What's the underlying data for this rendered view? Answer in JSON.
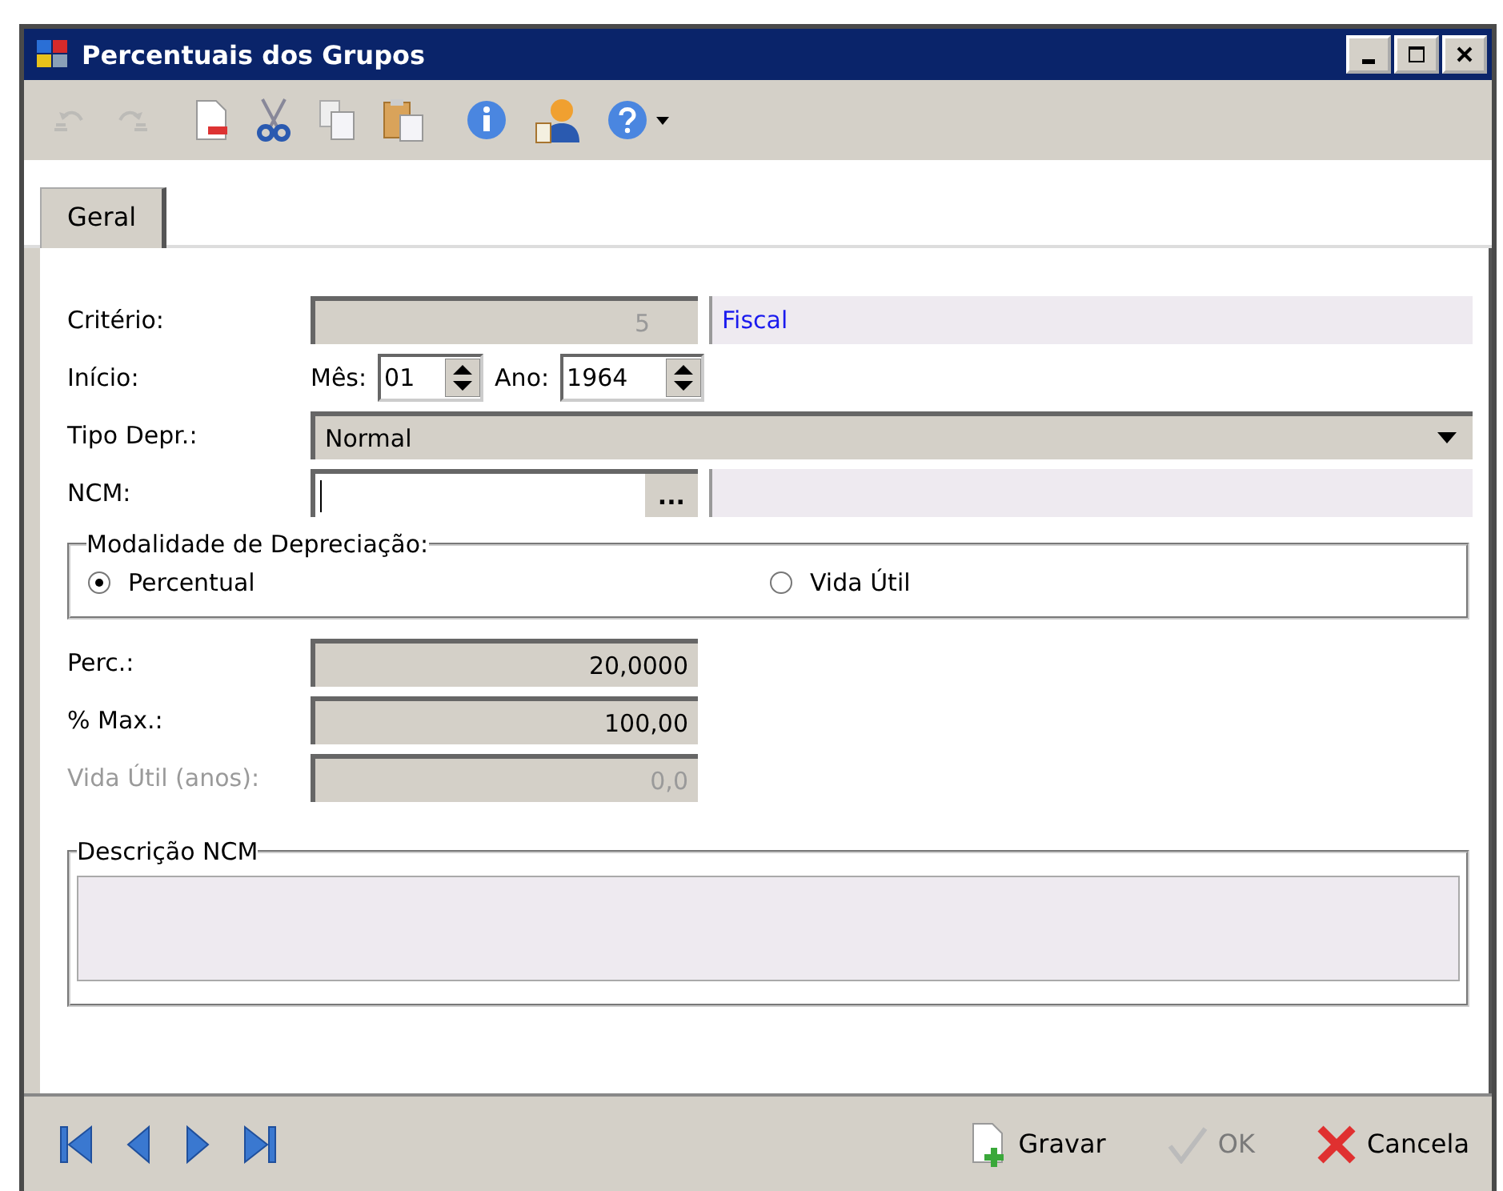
{
  "window": {
    "title": "Percentuais dos Grupos"
  },
  "toolbar": [
    {
      "kind": "undo",
      "disabled": true
    },
    {
      "kind": "redo",
      "disabled": true
    },
    {
      "kind": "delete",
      "disabled": false
    },
    {
      "kind": "cut",
      "disabled": false
    },
    {
      "kind": "copy",
      "disabled": false
    },
    {
      "kind": "paste",
      "disabled": false
    },
    {
      "kind": "info",
      "disabled": false
    },
    {
      "kind": "user",
      "disabled": false
    },
    {
      "kind": "help",
      "disabled": false
    }
  ],
  "tabs": [
    {
      "label": "Geral",
      "selected": true
    }
  ],
  "form": {
    "criterio": {
      "label": "Critério:",
      "code": "5",
      "description": "Fiscal"
    },
    "inicio": {
      "label": "Início:",
      "month_label": "Mês:",
      "month": "01",
      "year_label": "Ano:",
      "year": "1964"
    },
    "tipo_depr": {
      "label": "Tipo Depr.:",
      "value": "Normal"
    },
    "ncm": {
      "label": "NCM:",
      "button": "..."
    },
    "modalidade": {
      "title": "Modalidade de Depreciação:",
      "options": [
        {
          "label": "Percentual",
          "selected": true
        },
        {
          "label": "Vida Útil",
          "selected": false
        }
      ]
    },
    "numbers": [
      {
        "label": "Perc.:",
        "value": "20,0000",
        "disabled": false
      },
      {
        "label": "% Max.:",
        "value": "100,00",
        "disabled": false
      },
      {
        "label": "Vida Útil (anos):",
        "value": "0,0",
        "disabled": true
      }
    ],
    "descricao": {
      "title": "Descrição NCM"
    }
  },
  "footer": {
    "nav": [
      {
        "kind": "first"
      },
      {
        "kind": "prev"
      },
      {
        "kind": "next"
      },
      {
        "kind": "last"
      }
    ],
    "buttons": [
      {
        "kind": "save",
        "label": "Gravar",
        "disabled": false
      },
      {
        "kind": "ok",
        "label": "OK",
        "disabled": true
      },
      {
        "kind": "cancel",
        "label": "Cancela",
        "disabled": false
      }
    ]
  }
}
